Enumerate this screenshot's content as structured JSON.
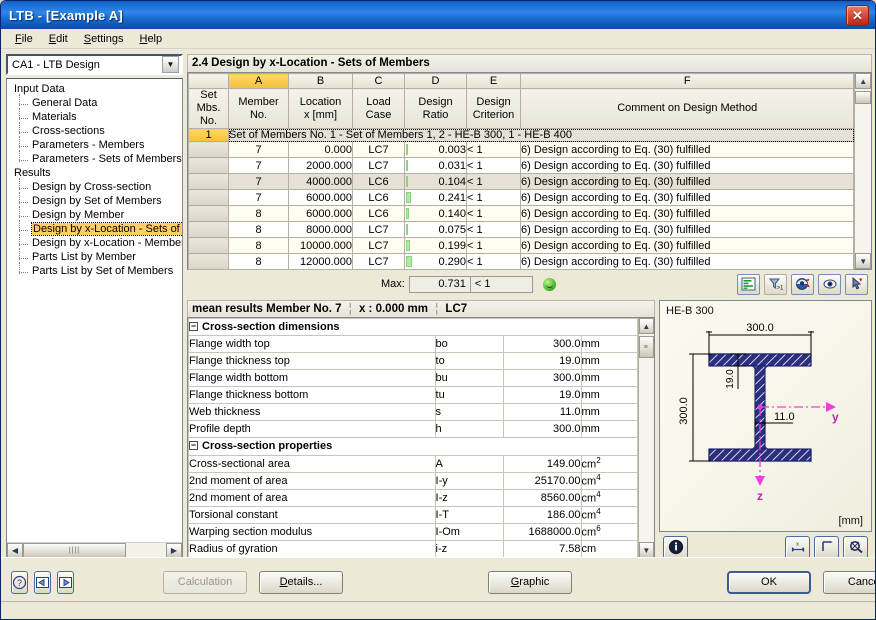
{
  "window": {
    "title": "LTB - [Example A]",
    "close_icon": "close-icon"
  },
  "menubar": {
    "items": [
      {
        "label": "File"
      },
      {
        "label": "Edit"
      },
      {
        "label": "Settings"
      },
      {
        "label": "Help"
      }
    ]
  },
  "sidebar": {
    "combo_value": "CA1 - LTB Design",
    "tree": [
      {
        "label": "Input Data",
        "type": "root"
      },
      {
        "label": "General Data",
        "type": "child"
      },
      {
        "label": "Materials",
        "type": "child"
      },
      {
        "label": "Cross-sections",
        "type": "child"
      },
      {
        "label": "Parameters - Members",
        "type": "child"
      },
      {
        "label": "Parameters - Sets of Members",
        "type": "child"
      },
      {
        "label": "Results",
        "type": "root"
      },
      {
        "label": "Design by Cross-section",
        "type": "child"
      },
      {
        "label": "Design by Set of Members",
        "type": "child"
      },
      {
        "label": "Design by Member",
        "type": "child"
      },
      {
        "label": "Design by x-Location - Sets of M",
        "type": "child",
        "selected": true
      },
      {
        "label": "Design by x-Location - Member:",
        "type": "child"
      },
      {
        "label": "Parts List by Member",
        "type": "child"
      },
      {
        "label": "Parts List by Set of Members",
        "type": "child"
      }
    ]
  },
  "main": {
    "section_title": "2.4 Design by x-Location - Sets of Members",
    "column_letters": [
      "A",
      "B",
      "C",
      "D",
      "E",
      "F"
    ],
    "active_column": "A",
    "headers": {
      "rowno": [
        "Set Mbs.",
        "No."
      ],
      "cols": [
        [
          "Member",
          "No."
        ],
        [
          "Location",
          "x [mm]"
        ],
        [
          "Load",
          "Case"
        ],
        [
          "Design",
          "Ratio"
        ],
        [
          "Design",
          "Criterion"
        ],
        [
          "",
          "Comment on Design Method"
        ]
      ]
    },
    "group_row": {
      "no": "1",
      "text": "Set of Members No.  1 - Set of Members 1, 2 - HE-B 300, 1 - HE-B 400"
    },
    "rows": [
      {
        "member": "7",
        "location": "0.000",
        "load_case": "LC7",
        "ratio": "0.003",
        "ratio_pct": 0.003,
        "criterion": "< 1",
        "comment": "6) Design according to Eq. (30) fulfilled",
        "stripe": "odd"
      },
      {
        "member": "7",
        "location": "2000.000",
        "load_case": "LC7",
        "ratio": "0.031",
        "ratio_pct": 0.031,
        "criterion": "< 1",
        "comment": "6) Design according to Eq. (30) fulfilled",
        "stripe": "even"
      },
      {
        "member": "7",
        "location": "4000.000",
        "load_case": "LC6",
        "ratio": "0.104",
        "ratio_pct": 0.104,
        "criterion": "< 1",
        "comment": "6) Design according to Eq. (30) fulfilled",
        "stripe": "hl"
      },
      {
        "member": "7",
        "location": "6000.000",
        "load_case": "LC6",
        "ratio": "0.241",
        "ratio_pct": 0.241,
        "criterion": "< 1",
        "comment": "6) Design according to Eq. (30) fulfilled",
        "stripe": "even"
      },
      {
        "member": "8",
        "location": "6000.000",
        "load_case": "LC6",
        "ratio": "0.140",
        "ratio_pct": 0.14,
        "criterion": "< 1",
        "comment": "6) Design according to Eq. (30) fulfilled",
        "stripe": "odd"
      },
      {
        "member": "8",
        "location": "8000.000",
        "load_case": "LC7",
        "ratio": "0.075",
        "ratio_pct": 0.075,
        "criterion": "< 1",
        "comment": "6) Design according to Eq. (30) fulfilled",
        "stripe": "even"
      },
      {
        "member": "8",
        "location": "10000.000",
        "load_case": "LC7",
        "ratio": "0.199",
        "ratio_pct": 0.199,
        "criterion": "< 1",
        "comment": "6) Design according to Eq. (30) fulfilled",
        "stripe": "odd"
      },
      {
        "member": "8",
        "location": "12000.000",
        "load_case": "LC7",
        "ratio": "0.290",
        "ratio_pct": 0.29,
        "criterion": "< 1",
        "comment": "6) Design according to Eq. (30) fulfilled",
        "stripe": "even"
      }
    ],
    "max": {
      "label": "Max:",
      "value": "0.731",
      "criterion": "< 1",
      "status_icon": "smiley-ok-icon"
    },
    "toolbar_icons": [
      {
        "name": "result-bars-icon"
      },
      {
        "name": "filter-greater-one-icon"
      },
      {
        "name": "color-view-icon"
      },
      {
        "name": "visibility-eye-icon"
      },
      {
        "name": "pick-selection-icon"
      }
    ]
  },
  "detail": {
    "header": {
      "prefix": "mean results Member No. 7",
      "location": "x : 0.000 mm",
      "load_case": "LC7"
    },
    "groups": [
      {
        "title": "Cross-section dimensions",
        "rows": [
          {
            "name": "Flange width top",
            "symbol": "bo",
            "value": "300.0",
            "unit": "mm"
          },
          {
            "name": "Flange thickness top",
            "symbol": "to",
            "value": "19.0",
            "unit": "mm"
          },
          {
            "name": "Flange width bottom",
            "symbol": "bu",
            "value": "300.0",
            "unit": "mm"
          },
          {
            "name": "Flange thickness bottom",
            "symbol": "tu",
            "value": "19.0",
            "unit": "mm"
          },
          {
            "name": "Web thickness",
            "symbol": "s",
            "value": "11.0",
            "unit": "mm"
          },
          {
            "name": "Profile depth",
            "symbol": "h",
            "value": "300.0",
            "unit": "mm"
          }
        ]
      },
      {
        "title": "Cross-section properties",
        "rows": [
          {
            "name": "Cross-sectional area",
            "symbol": "A",
            "value": "149.00",
            "unit": "cm",
            "sup": "2"
          },
          {
            "name": "2nd moment of area",
            "symbol": "I-y",
            "value": "25170.00",
            "unit": "cm",
            "sup": "4"
          },
          {
            "name": "2nd moment of area",
            "symbol": "I-z",
            "value": "8560.00",
            "unit": "cm",
            "sup": "4"
          },
          {
            "name": "Torsional constant",
            "symbol": "I-T",
            "value": "186.00",
            "unit": "cm",
            "sup": "4"
          },
          {
            "name": "Warping section modulus",
            "symbol": "I-Om",
            "value": "1688000.0",
            "unit": "cm",
            "sup": "6"
          },
          {
            "name": "Radius of gyration",
            "symbol": "i-z",
            "value": "7.58",
            "unit": "cm",
            "sup": ""
          }
        ]
      }
    ]
  },
  "cross_section": {
    "name": "HE-B 300",
    "unit_note": "[mm]",
    "dim_width": "300.0",
    "dim_depth": "300.0",
    "dim_flange": "19.0",
    "dim_web": "11.0",
    "axis_y": "y",
    "axis_z": "z",
    "toolbar_icons": [
      {
        "name": "info-icon"
      },
      {
        "name": "dimensions-icon"
      },
      {
        "name": "axes-icon"
      },
      {
        "name": "zoom-icon"
      }
    ]
  },
  "footer": {
    "help_icon": "help-question-icon",
    "prev_icon": "previous-arrow-icon",
    "next_icon": "next-arrow-icon",
    "calculation": "Calculation",
    "details": "Details...",
    "graphic": "Graphic",
    "ok": "OK",
    "cancel": "Cancel"
  },
  "colors": {
    "accent_blue": "#0d52b0",
    "highlight_yellow": "#ffcc66",
    "ratio_green": "#a9ef9f",
    "close_red": "#b8271a"
  }
}
